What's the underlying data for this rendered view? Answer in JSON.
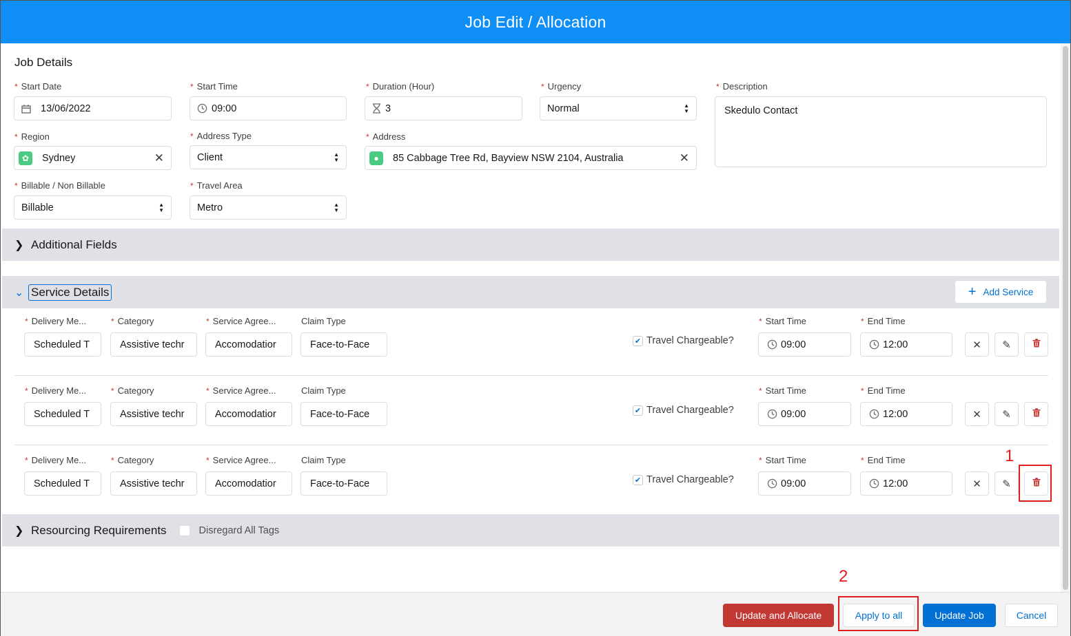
{
  "header": {
    "title": "Job Edit / Allocation"
  },
  "job_details": {
    "title": "Job Details",
    "start_date": {
      "label": "Start Date",
      "value": "13/06/2022",
      "icon": "calendar-icon"
    },
    "start_time": {
      "label": "Start Time",
      "value": "09:00",
      "icon": "clock-icon"
    },
    "duration": {
      "label": "Duration (Hour)",
      "value": "3",
      "icon": "hourglass-icon"
    },
    "urgency": {
      "label": "Urgency",
      "value": "Normal"
    },
    "description": {
      "label": "Description",
      "value": "Skedulo Contact"
    },
    "region": {
      "label": "Region",
      "value": "Sydney",
      "icon": "region-icon"
    },
    "address_type": {
      "label": "Address Type",
      "value": "Client"
    },
    "address": {
      "label": "Address",
      "value": "85 Cabbage Tree Rd, Bayview NSW 2104, Australia",
      "icon": "location-pin-icon"
    },
    "billable": {
      "label": "Billable / Non Billable",
      "value": "Billable"
    },
    "travel_area": {
      "label": "Travel Area",
      "value": "Metro"
    }
  },
  "additional_fields": {
    "title": "Additional Fields"
  },
  "service_details": {
    "title": "Service Details",
    "add_label": "Add Service",
    "labels": {
      "delivery": "Delivery Me...",
      "category": "Category",
      "agreement": "Service Agree...",
      "claim": "Claim Type",
      "travel": "Travel Chargeable?",
      "start": "Start Time",
      "end": "End Time"
    },
    "rows": [
      {
        "delivery": "Scheduled T",
        "category": "Assistive techr",
        "agreement": "Accomodatior",
        "claim": "Face-to-Face",
        "travel_checked": true,
        "start": "09:00",
        "end": "12:00"
      },
      {
        "delivery": "Scheduled T",
        "category": "Assistive techr",
        "agreement": "Accomodatior",
        "claim": "Face-to-Face",
        "travel_checked": true,
        "start": "09:00",
        "end": "12:00"
      },
      {
        "delivery": "Scheduled T",
        "category": "Assistive techr",
        "agreement": "Accomodatior",
        "claim": "Face-to-Face",
        "travel_checked": true,
        "start": "09:00",
        "end": "12:00"
      }
    ]
  },
  "resourcing": {
    "title": "Resourcing Requirements",
    "disregard_label": "Disregard All Tags"
  },
  "annotations": {
    "callout_1": "1",
    "callout_2": "2",
    "highlight_color": "#e01e1e"
  },
  "footer": {
    "update_allocate": "Update and Allocate",
    "apply_all": "Apply to all",
    "update_job": "Update Job",
    "cancel": "Cancel"
  },
  "colors": {
    "header": "#0f8ef5",
    "accent": "#0070d2",
    "danger": "#c23934",
    "section_bar": "#dfe1e6"
  }
}
